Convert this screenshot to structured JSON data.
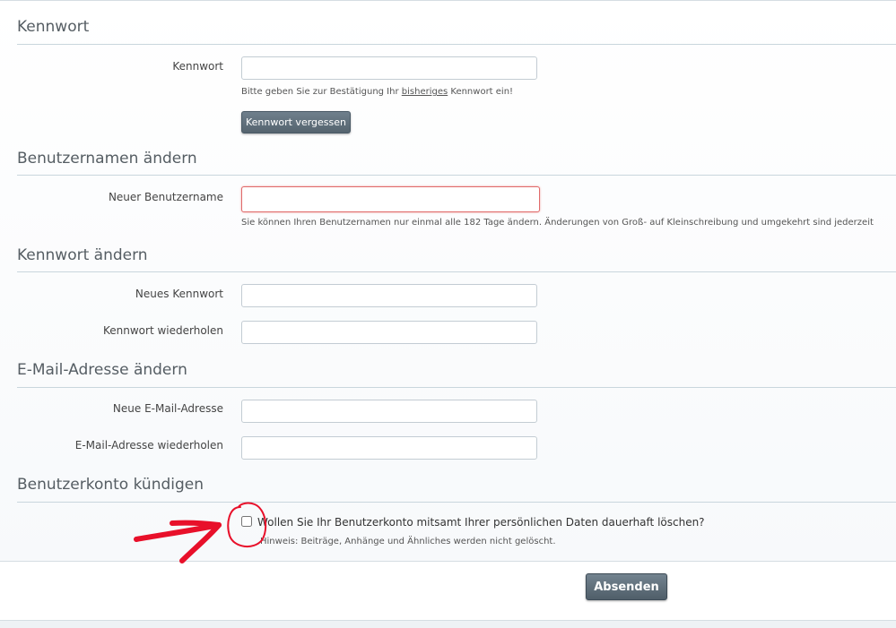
{
  "sections": {
    "password_confirm": {
      "title": "Kennwort",
      "label": "Kennwort",
      "value": "",
      "hint_prefix": "Bitte geben Sie zur Bestätigung Ihr ",
      "hint_emphasis": "bisheriges",
      "hint_suffix": " Kennwort ein!",
      "forgot_button": "Kennwort vergessen"
    },
    "username": {
      "title": "Benutzernamen ändern",
      "label": "Neuer Benutzername",
      "value": "",
      "hint": "Sie können Ihren Benutzernamen nur einmal alle 182 Tage ändern. Änderungen von Groß- auf Kleinschreibung und umgekehrt sind jederzeit"
    },
    "password_change": {
      "title": "Kennwort ändern",
      "new_label": "Neues Kennwort",
      "new_value": "",
      "repeat_label": "Kennwort wiederholen",
      "repeat_value": ""
    },
    "email": {
      "title": "E-Mail-Adresse ändern",
      "new_label": "Neue E-Mail-Adresse",
      "new_value": "",
      "repeat_label": "E-Mail-Adresse wiederholen",
      "repeat_value": ""
    },
    "delete_account": {
      "title": "Benutzerkonto kündigen",
      "checkbox_label": "Wollen Sie Ihr Benutzerkonto mitsamt Ihrer persönlichen Daten dauerhaft löschen?",
      "checkbox_hint": "Hinweis: Beiträge, Anhänge und Ähnliches werden nicht gelöscht.",
      "checked": false
    }
  },
  "submit": {
    "label": "Absenden"
  },
  "colors": {
    "annotation": "#e8102a",
    "button": "#5f6e7a",
    "error_border": "#e06b6b"
  }
}
